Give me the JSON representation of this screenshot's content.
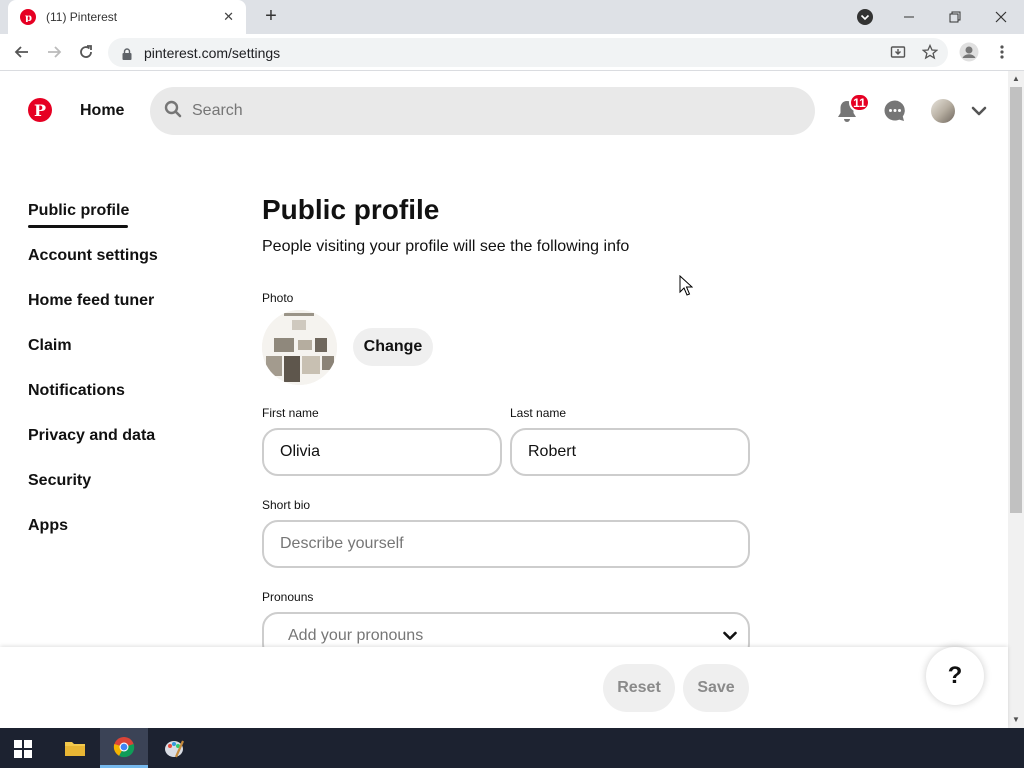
{
  "browser": {
    "tab_title": "(11) Pinterest",
    "url": "pinterest.com/settings"
  },
  "header": {
    "home_label": "Home",
    "search_placeholder": "Search",
    "notification_count": "11"
  },
  "sidebar": {
    "items": [
      {
        "label": "Public profile"
      },
      {
        "label": "Account settings"
      },
      {
        "label": "Home feed tuner"
      },
      {
        "label": "Claim"
      },
      {
        "label": "Notifications"
      },
      {
        "label": "Privacy and data"
      },
      {
        "label": "Security"
      },
      {
        "label": "Apps"
      }
    ]
  },
  "main": {
    "title": "Public profile",
    "subtitle": "People visiting your profile will see the following info",
    "photo_label": "Photo",
    "change_label": "Change",
    "first_name_label": "First name",
    "first_name_value": "Olivia",
    "last_name_label": "Last name",
    "last_name_value": "Robert",
    "bio_label": "Short bio",
    "bio_placeholder": "Describe yourself",
    "pronouns_label": "Pronouns",
    "pronouns_placeholder": "Add your pronouns"
  },
  "footer": {
    "reset_label": "Reset",
    "save_label": "Save",
    "help_label": "?"
  },
  "colors": {
    "brand": "#e60023",
    "active_text": "#111111"
  }
}
